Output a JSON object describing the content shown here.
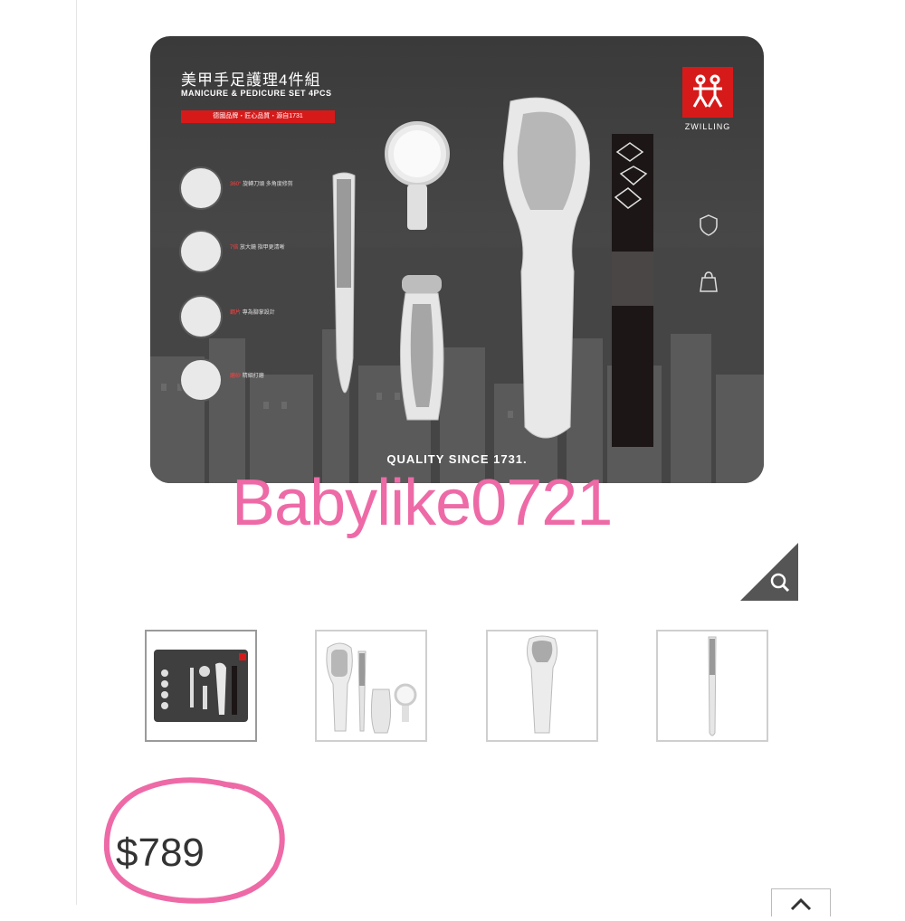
{
  "product_image": {
    "title_cn": "美甲手足護理4件組",
    "title_en": "MANICURE & PEDICURE SET 4PCS",
    "red_tagline": "德國品牌・匠心品質・源自1731",
    "brand": "ZWILLING",
    "features": [
      {
        "highlight": "360°",
        "text": "旋轉刀頭 多角度修剪"
      },
      {
        "highlight": "7倍",
        "text": "放大鏡 指甲更清晰"
      },
      {
        "highlight": "鋼片",
        "text": "專為腳掌設計"
      },
      {
        "highlight": "磨砂",
        "text": "精細打磨"
      }
    ],
    "side_labels": [
      "優質不鏽鋼",
      "方便收納"
    ],
    "quality_text": "QUALITY SINCE 1731."
  },
  "watermark": "Babylike0721",
  "thumbnails": [
    {
      "label": "set-overview"
    },
    {
      "label": "all-tools"
    },
    {
      "label": "foot-file"
    },
    {
      "label": "nail-file"
    }
  ],
  "price": "$789",
  "icons": {
    "zoom": "magnifier-icon",
    "back_to_top": "chevron-up-icon"
  },
  "colors": {
    "brand_red": "#d61a1a",
    "watermark_pink": "#ee6aa7",
    "zoom_bg": "#555555"
  }
}
